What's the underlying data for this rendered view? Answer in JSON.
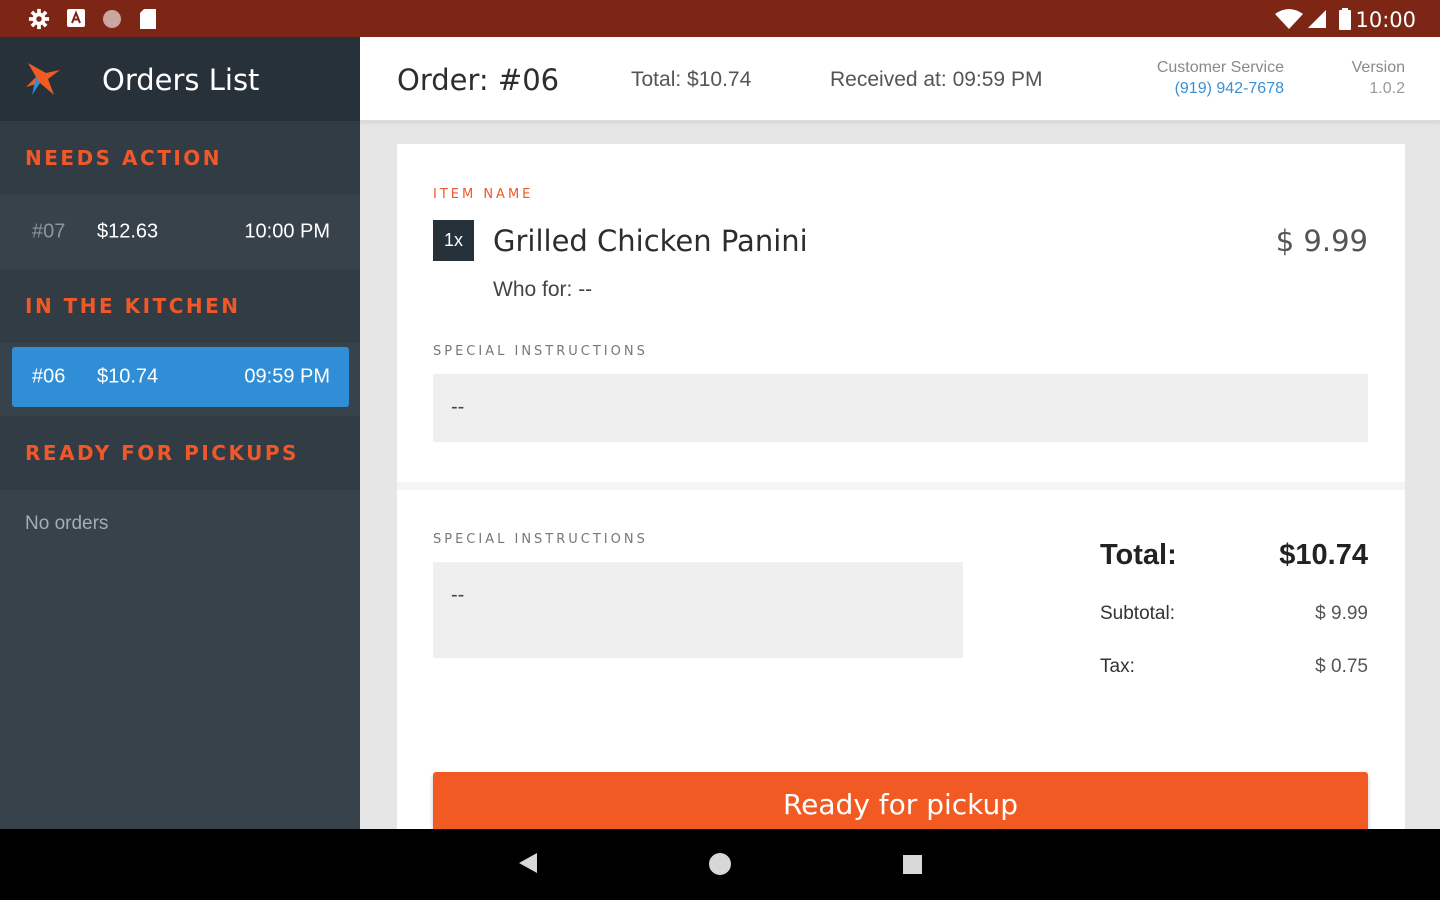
{
  "status_bar": {
    "time": "10:00",
    "icons": [
      "gear-icon",
      "a-icon",
      "circle-icon",
      "sd-card-icon",
      "wifi-icon",
      "signal-icon",
      "battery-icon"
    ]
  },
  "sidebar": {
    "title": "Orders List",
    "sections": [
      {
        "label": "NEEDS ACTION",
        "orders": [
          {
            "number": "#07",
            "amount": "$12.63",
            "time": "10:00 PM"
          }
        ]
      },
      {
        "label": "IN THE KITCHEN",
        "orders": [
          {
            "number": "#06",
            "amount": "$10.74",
            "time": "09:59 PM"
          }
        ]
      },
      {
        "label": "READY FOR PICKUPS",
        "empty_text": "No orders"
      }
    ]
  },
  "header": {
    "order_title": "Order: #06",
    "total": "Total: $10.74",
    "received": "Received at: 09:59 PM",
    "customer_service_label": "Customer Service",
    "customer_service_phone": "(919) 942-7678",
    "version_label": "Version",
    "version_value": "1.0.2"
  },
  "item": {
    "section_label": "ITEM NAME",
    "quantity": "1x",
    "name": "Grilled Chicken Panini",
    "price": "$ 9.99",
    "who_for": "Who for: --",
    "special_instructions_label": "SPECIAL INSTRUCTIONS",
    "special_instructions": "--"
  },
  "order_summary": {
    "special_instructions_label": "SPECIAL INSTRUCTIONS",
    "special_instructions": "--",
    "total_label": "Total:",
    "total_value": "$10.74",
    "subtotal_label": "Subtotal:",
    "subtotal_value": "$ 9.99",
    "tax_label": "Tax:",
    "tax_value": "$ 0.75",
    "action_button": "Ready for pickup"
  },
  "colors": {
    "accent": "#f15a22",
    "selected": "#2f8ed6",
    "sidebar": "#37424b",
    "status_bar": "#7e2616",
    "link": "#3b8fd4"
  }
}
